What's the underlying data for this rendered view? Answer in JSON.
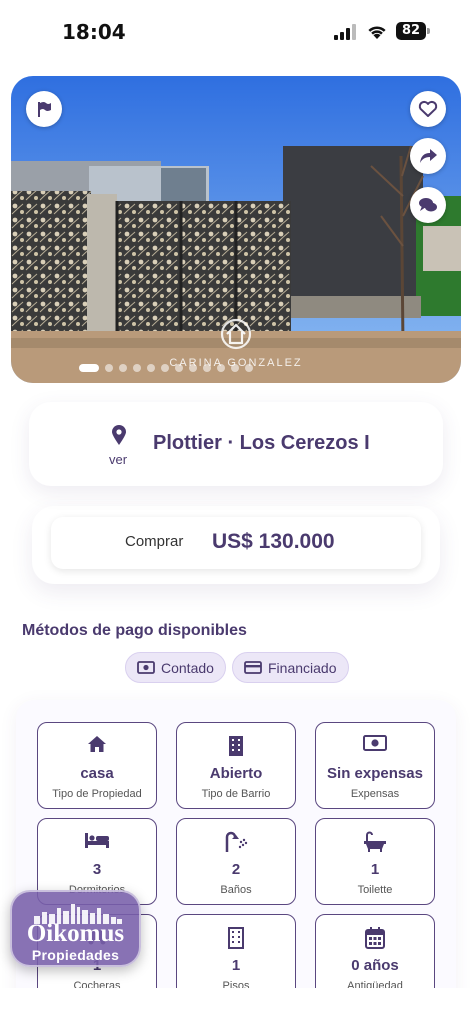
{
  "status_bar": {
    "time": "18:04",
    "battery": "82"
  },
  "hero": {
    "watermark": "CARINA GONZALEZ",
    "slides_total": 12,
    "slide_active": 1
  },
  "location": {
    "title": "Plottier · Los Cerezos I",
    "map_link": "ver"
  },
  "price": {
    "operation": "Comprar",
    "amount": "US$ 130.000"
  },
  "payment": {
    "title": "Métodos de pago disponibles",
    "methods": [
      {
        "label": "Contado",
        "icon": "cash-icon"
      },
      {
        "label": "Financiado",
        "icon": "credit-card-icon"
      }
    ]
  },
  "features": [
    {
      "value": "casa",
      "label": "Tipo de Propiedad",
      "icon": "house-icon"
    },
    {
      "value": "Abierto",
      "label": "Tipo de Barrio",
      "icon": "building-icon"
    },
    {
      "value": "Sin expensas",
      "label": "Expensas",
      "icon": "money-bill-icon"
    },
    {
      "value": "3",
      "label": "Dormitorios",
      "icon": "bed-icon"
    },
    {
      "value": "2",
      "label": "Baños",
      "icon": "shower-icon"
    },
    {
      "value": "1",
      "label": "Toilette",
      "icon": "bathtub-icon"
    },
    {
      "value": "1",
      "label": "Cocheras",
      "icon": "car-icon"
    },
    {
      "value": "1",
      "label": "Pisos",
      "icon": "building-icon"
    },
    {
      "value": "0 años",
      "label": "Antigüedad",
      "icon": "calendar-icon"
    }
  ],
  "brand_badge": {
    "name": "Oikomus",
    "subtitle": "Propiedades"
  },
  "colors": {
    "brand": "#4a3a6e",
    "accent": "#5a4780",
    "chip_bg": "#ece7f7"
  }
}
